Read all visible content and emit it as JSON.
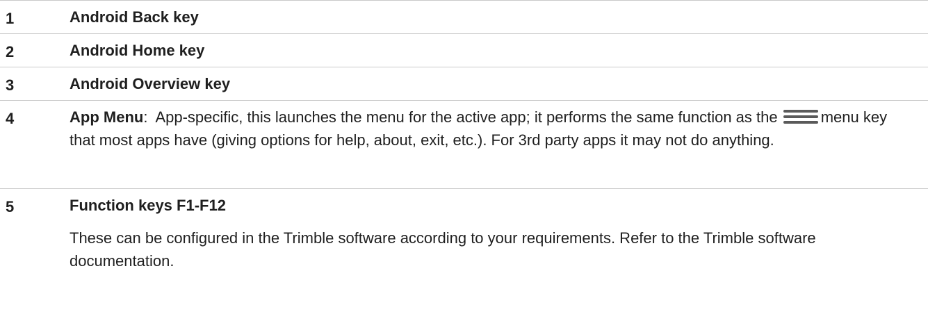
{
  "rows": [
    {
      "number": "1",
      "term": "Android Back key"
    },
    {
      "number": "2",
      "term": "Android Home key"
    },
    {
      "number": "3",
      "term": "Android Overview key"
    },
    {
      "number": "4",
      "term": "App Menu",
      "colon": ":",
      "desc_before_icon": "  App-specific, this launches the menu for the active app; it performs the same function as the",
      "icon": "hamburger-menu-icon",
      "desc_after_icon": "menu key that most apps have (giving options for help, about, exit, etc.). For 3rd party apps it may not do anything."
    },
    {
      "number": "5",
      "term": "Function keys F1-F12",
      "description": "These can be configured in the Trimble software according to your requirements. Refer to the Trimble software documentation."
    }
  ],
  "colors": {
    "divider": "#c9c9c9",
    "text": "#1f1f1f",
    "icon": "#5a5a5a"
  }
}
